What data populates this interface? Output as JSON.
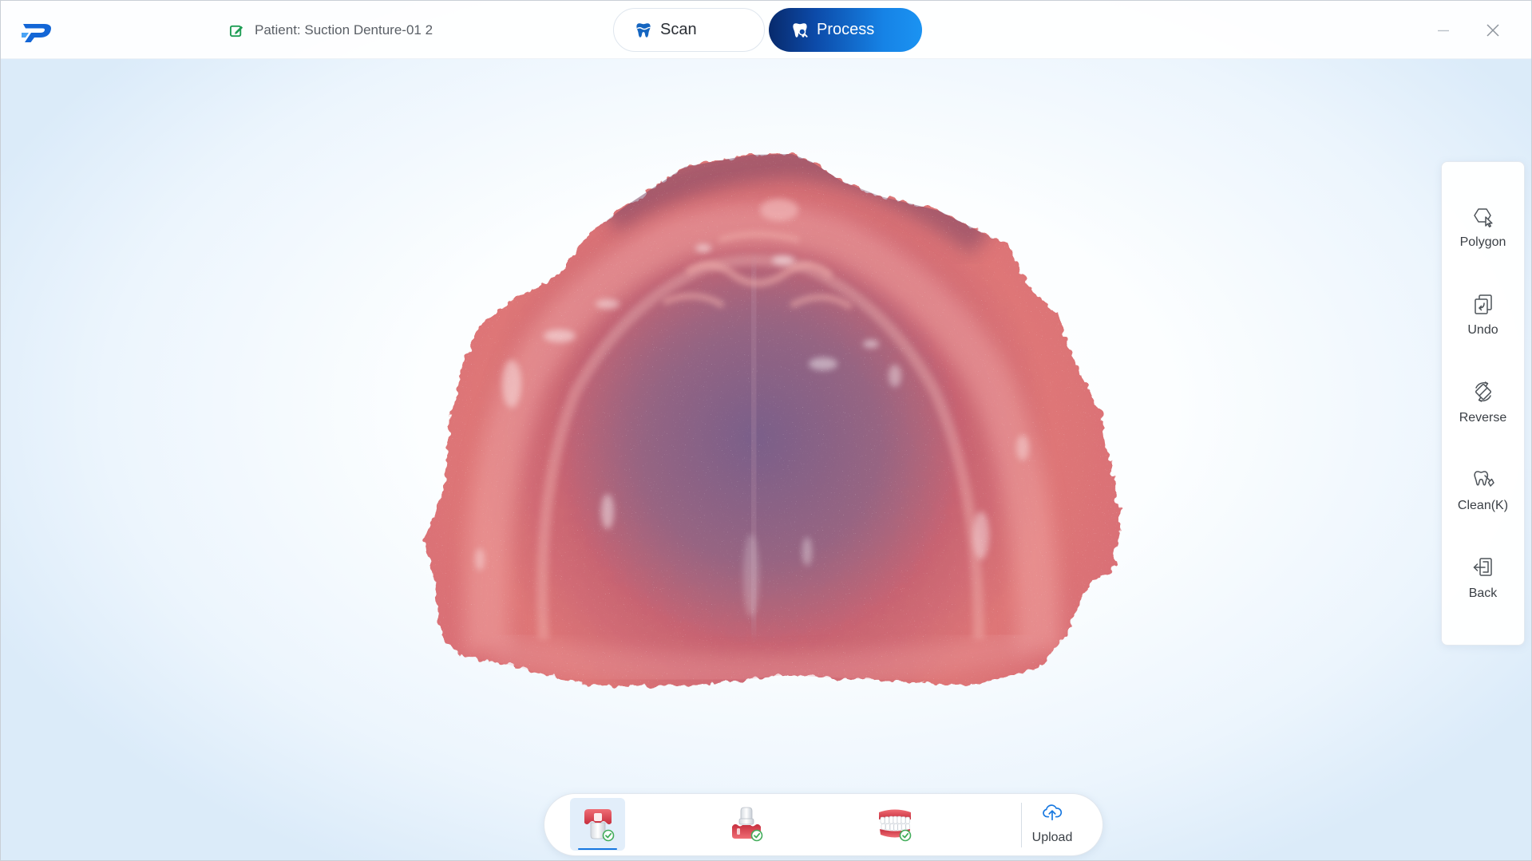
{
  "window": {
    "patient_label": "Patient:",
    "patient_name": "Suction Denture-01 2",
    "logo_icon": "app-logo-icon",
    "edit_icon": "edit-icon",
    "minimize_icon": "minimize-icon",
    "close_icon": "close-icon"
  },
  "tabs": [
    {
      "label": "Scan",
      "icon": "tooth-scan-icon",
      "active": false
    },
    {
      "label": "Process",
      "icon": "tooth-process-icon",
      "active": true
    }
  ],
  "side_toolbar": {
    "items": [
      {
        "label": "Polygon",
        "icon": "polygon-select-icon"
      },
      {
        "label": "Undo",
        "icon": "undo-icon"
      },
      {
        "label": "Reverse",
        "icon": "reverse-icon"
      },
      {
        "label": "Clean(K)",
        "icon": "clean-icon"
      },
      {
        "label": "Back",
        "icon": "back-icon"
      }
    ]
  },
  "workflow_toolbar": {
    "steps": [
      {
        "icon": "upper-jaw-icon",
        "completed": true,
        "selected": true
      },
      {
        "icon": "lower-jaw-icon",
        "completed": true,
        "selected": false
      },
      {
        "icon": "occlusion-icon",
        "completed": true,
        "selected": false
      }
    ],
    "upload": {
      "label": "Upload",
      "icon": "cloud-upload-icon"
    }
  },
  "colors": {
    "accent": "#1677e0",
    "process_tab_start": "#082a6c",
    "process_tab_end": "#1b93f2",
    "completed_check": "#43ad5b",
    "edit_icon": "#1f9d55",
    "gum": "#d9646c",
    "palate_center": "#8c6486"
  }
}
